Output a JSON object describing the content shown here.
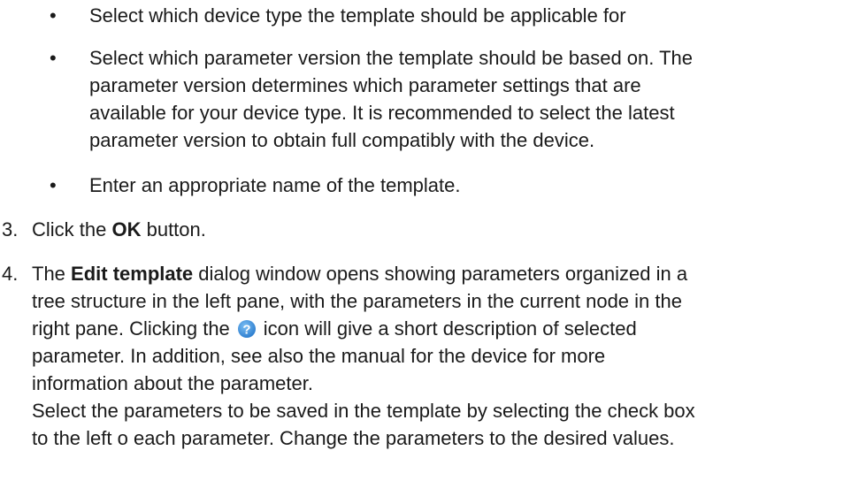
{
  "bullets": [
    {
      "symbol": "•",
      "text": "Select which device type the template should be applicable for"
    },
    {
      "symbol": "•",
      "lines": [
        "Select which parameter version the template should be based on. The",
        "parameter version determines which parameter settings that are",
        "available for your device type. It is recommended to select the latest",
        "parameter version to obtain full compatibly with the device."
      ]
    },
    {
      "symbol": "•",
      "text": "Enter an appropriate name of the template."
    }
  ],
  "steps": [
    {
      "number": "3.",
      "before": "Click the ",
      "bold": "OK",
      "after": " button."
    },
    {
      "number": "4.",
      "line1_before": "The ",
      "line1_bold": "Edit template",
      "line1_after": " dialog window opens showing parameters organized in a",
      "line2": "tree structure in the left pane, with the parameters in the current node in the",
      "line3_before": "right pane. Clicking the",
      "line3_icon": "help-icon",
      "line3_after": "icon will give a short description of selected",
      "line4": "parameter. In addition, see also the manual for the device for more",
      "line5": "information about the parameter.",
      "line6": "Select the parameters to be saved in the template by selecting the check box",
      "line7": "to the left o each parameter. Change the parameters to the desired values."
    }
  ],
  "colors": {
    "text": "#1a1a1a",
    "help_icon_fill": "#3a8fd9",
    "help_icon_glyph": "#ffffff"
  }
}
